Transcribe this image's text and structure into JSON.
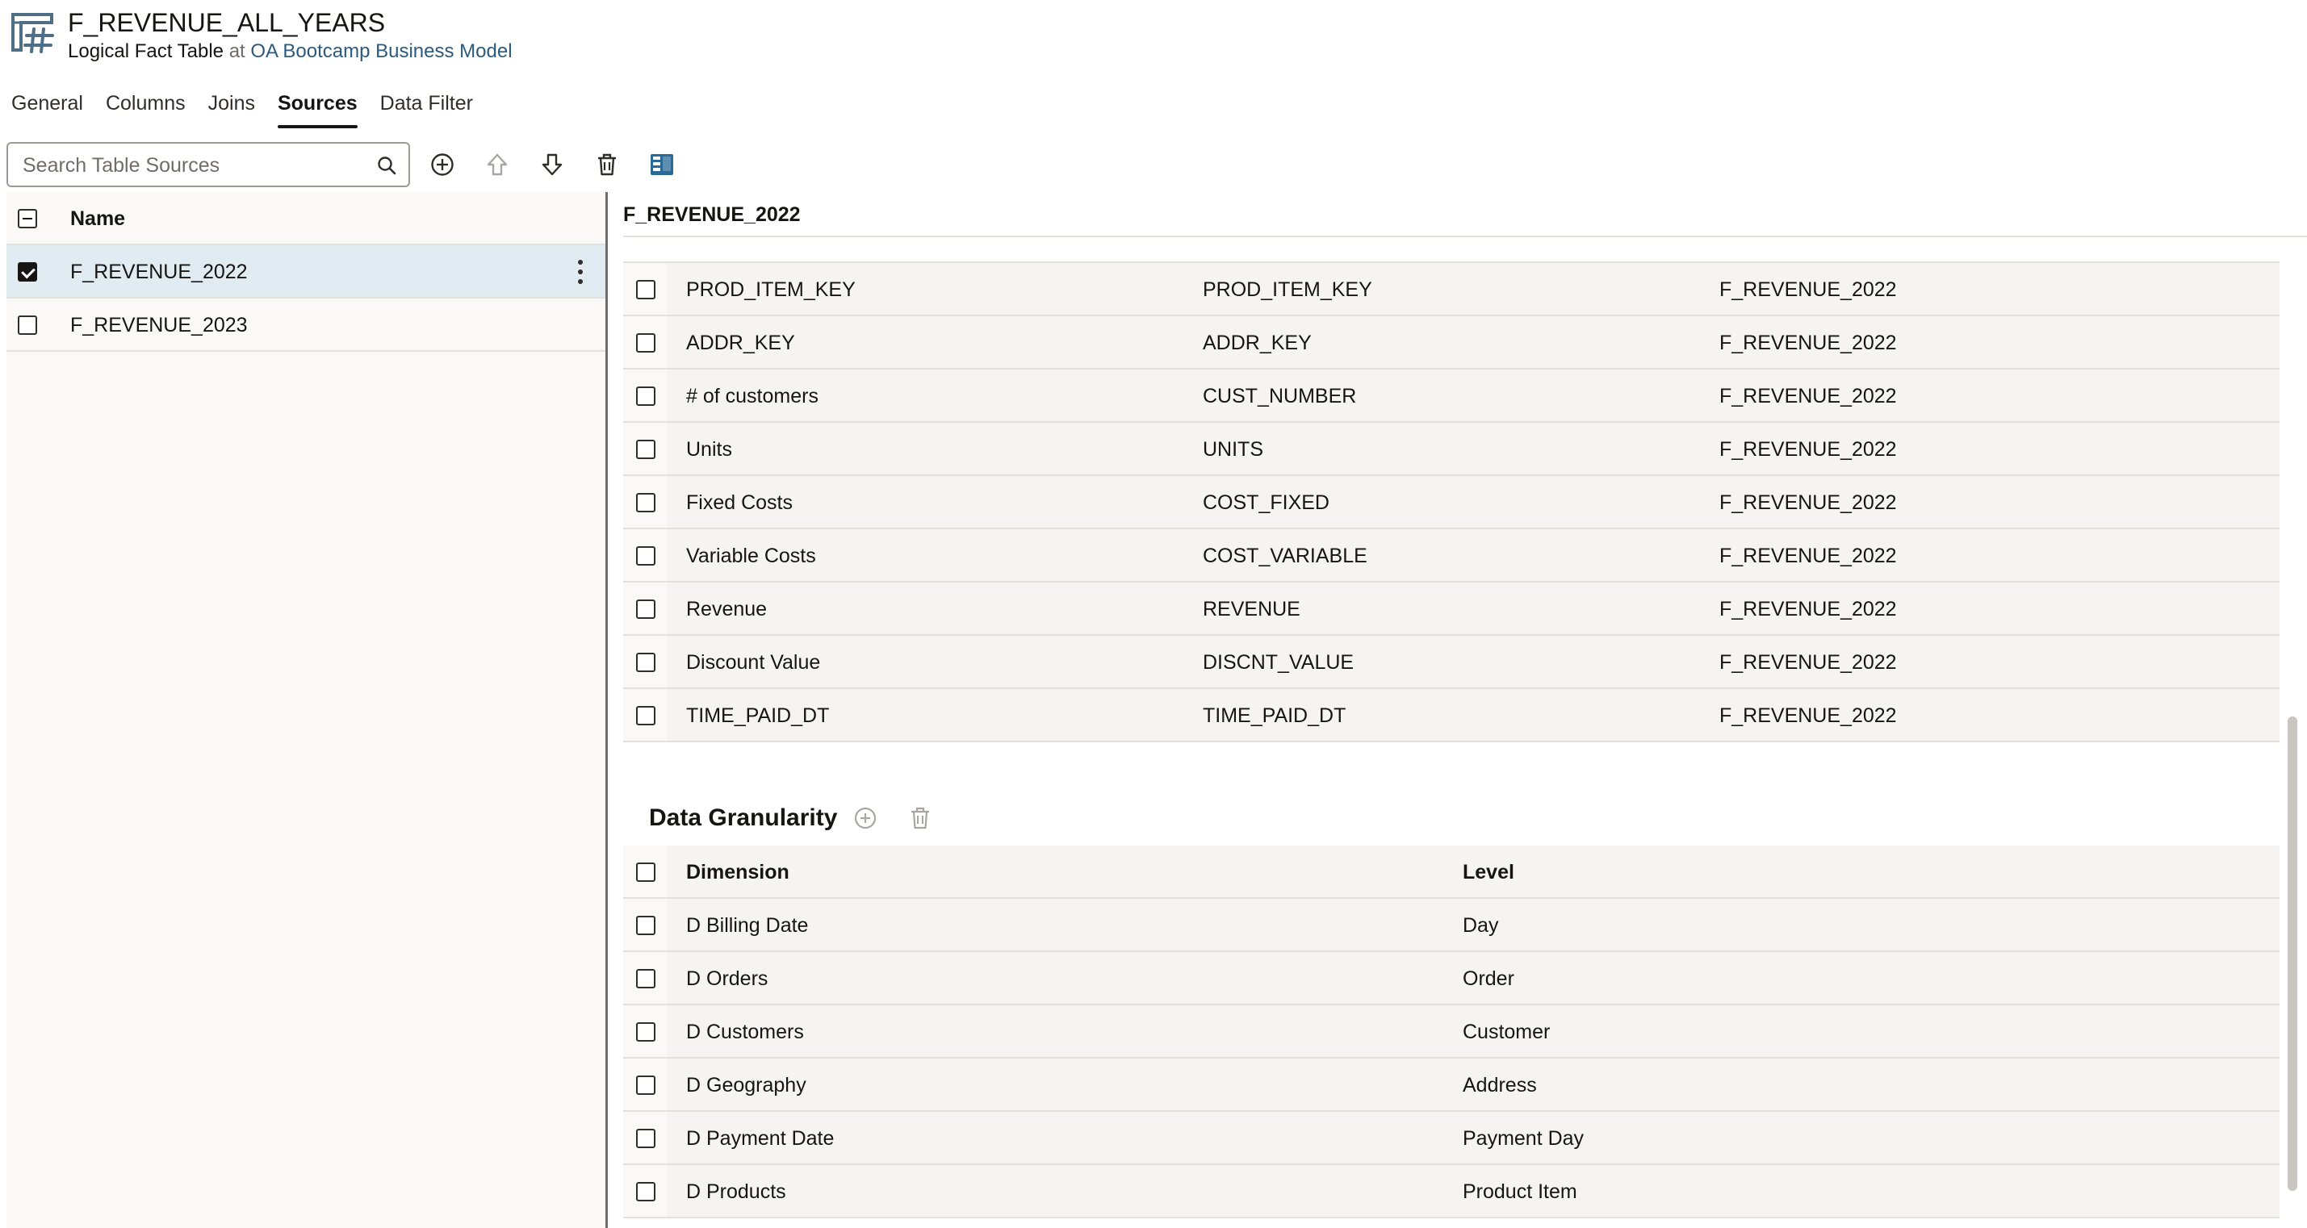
{
  "header": {
    "title": "F_REVENUE_ALL_YEARS",
    "subtitle_type": "Logical Fact Table",
    "subtitle_at": "at",
    "subtitle_link": "OA Bootcamp Business Model",
    "icon": "logical-fact-table-icon"
  },
  "tabs": [
    {
      "label": "General",
      "active": false
    },
    {
      "label": "Columns",
      "active": false
    },
    {
      "label": "Joins",
      "active": false
    },
    {
      "label": "Sources",
      "active": true
    },
    {
      "label": "Data Filter",
      "active": false
    }
  ],
  "toolbar": {
    "search_placeholder": "Search Table Sources",
    "icons": [
      "search-icon",
      "add-icon",
      "move-up-icon",
      "move-down-icon",
      "delete-icon",
      "panel-layout-icon"
    ]
  },
  "sources": {
    "header": "Name",
    "items": [
      {
        "name": "F_REVENUE_2022",
        "checked": true,
        "selected": true
      },
      {
        "name": "F_REVENUE_2023",
        "checked": false,
        "selected": false
      }
    ]
  },
  "detail": {
    "title": "F_REVENUE_2022",
    "mappings": [
      {
        "logical": "PROD_ITEM_KEY",
        "physical": "PROD_ITEM_KEY",
        "table": "F_REVENUE_2022"
      },
      {
        "logical": "ADDR_KEY",
        "physical": "ADDR_KEY",
        "table": "F_REVENUE_2022"
      },
      {
        "logical": "# of customers",
        "physical": "CUST_NUMBER",
        "table": "F_REVENUE_2022"
      },
      {
        "logical": "Units",
        "physical": "UNITS",
        "table": "F_REVENUE_2022"
      },
      {
        "logical": "Fixed Costs",
        "physical": "COST_FIXED",
        "table": "F_REVENUE_2022"
      },
      {
        "logical": "Variable Costs",
        "physical": "COST_VARIABLE",
        "table": "F_REVENUE_2022"
      },
      {
        "logical": "Revenue",
        "physical": "REVENUE",
        "table": "F_REVENUE_2022"
      },
      {
        "logical": "Discount Value",
        "physical": "DISCNT_VALUE",
        "table": "F_REVENUE_2022"
      },
      {
        "logical": "TIME_PAID_DT",
        "physical": "TIME_PAID_DT",
        "table": "F_REVENUE_2022"
      }
    ],
    "granularity": {
      "title": "Data Granularity",
      "columns": {
        "dimension": "Dimension",
        "level": "Level"
      },
      "rows": [
        {
          "dimension": "D Billing Date",
          "level": "Day"
        },
        {
          "dimension": "D Orders",
          "level": "Order"
        },
        {
          "dimension": "D Customers",
          "level": "Customer"
        },
        {
          "dimension": "D Geography",
          "level": "Address"
        },
        {
          "dimension": "D Payment Date",
          "level": "Payment Day"
        },
        {
          "dimension": "D Products",
          "level": "Product Item"
        }
      ]
    }
  },
  "colors": {
    "accent_link": "#2b5a7e",
    "selected_row": "#e1ebf2",
    "layout_icon": "#2b6a94",
    "text": "#161513"
  }
}
